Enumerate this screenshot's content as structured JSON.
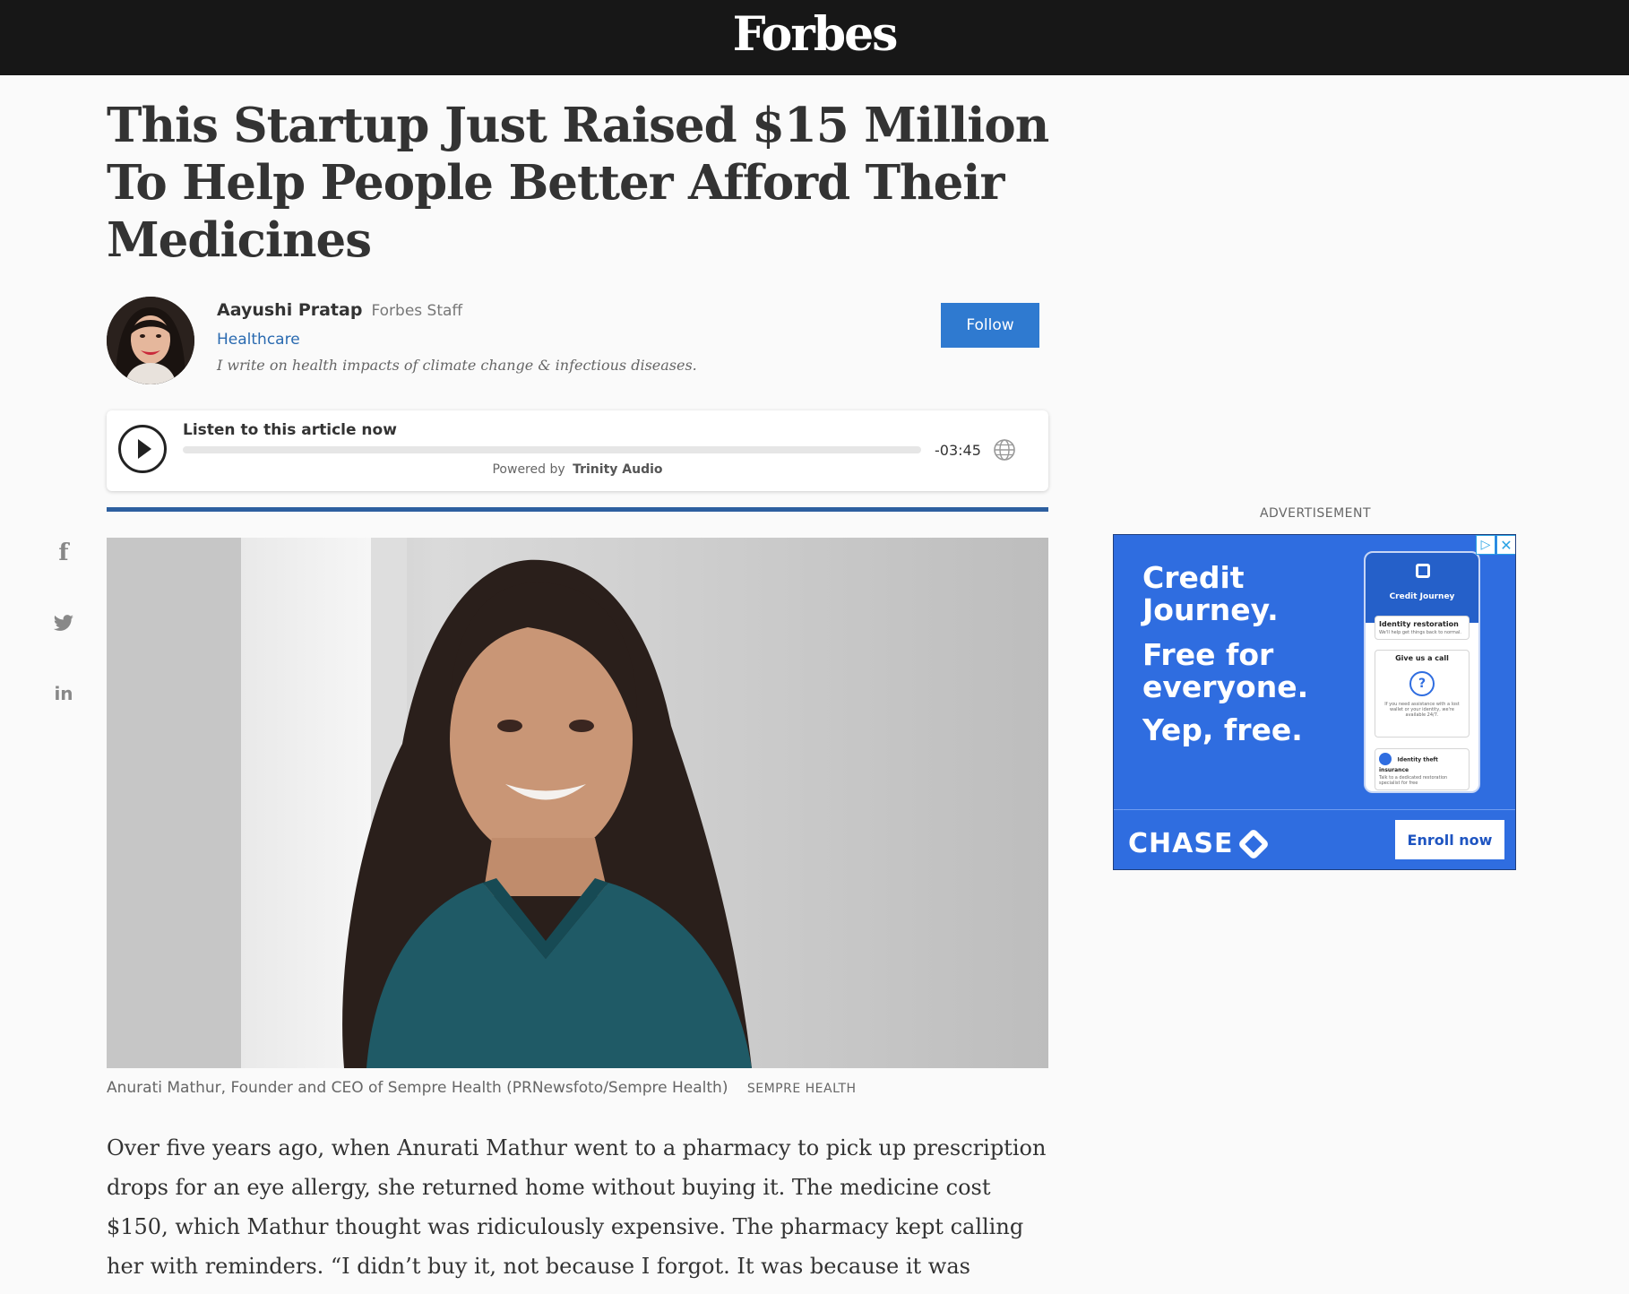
{
  "header": {
    "brand": "Forbes"
  },
  "article": {
    "headline": "This Startup Just Raised $15 Million To Help People Better Afford Their Medicines",
    "author": {
      "name": "Aayushi Pratap",
      "role": "Forbes Staff",
      "category": "Healthcare",
      "bio": "I write on health impacts of climate change & infectious diseases.",
      "follow_label": "Follow"
    },
    "audio": {
      "title": "Listen to this article now",
      "time": "-03:45",
      "powered_by": "Powered by",
      "provider": "Trinity Audio",
      "progress": 0
    },
    "image": {
      "caption": "Anurati Mathur, Founder and CEO of Sempre Health (PRNewsfoto/Sempre Health)",
      "credit": "SEMPRE HEALTH"
    },
    "body": "Over five years ago, when Anurati Mathur went to a pharmacy to pick up prescription drops for an eye allergy, she returned home without buying it. The medicine cost $150, which Mathur thought was ridiculously expensive. The pharmacy kept calling her with reminders. “I didn’t buy it, not because I forgot. It was because it was unaffordable,”"
  },
  "share": {
    "facebook": "f",
    "twitter": "twitter-bird-icon",
    "linkedin": "in"
  },
  "ad": {
    "label": "ADVERTISEMENT",
    "headline_1": "Credit",
    "headline_2": "Journey.",
    "sub_1": "Free for",
    "sub_2": "everyone.",
    "sub_3": "Yep, free.",
    "phone_title": "Credit Journey",
    "card1_title": "Identity restoration",
    "card1_text": "We'll help get things back to normal.",
    "card2_title": "Give us a call",
    "card2_text": "If you need assistance with a lost wallet or your identity, we're available 24/7.",
    "card3_title": "Identity theft insurance",
    "card3_text": "Talk to a dedicated restoration specialist for free",
    "brand": "CHASE",
    "cta": "Enroll now",
    "colors": {
      "background": "#2f6de0",
      "brand_blue": "#1f55c1"
    }
  },
  "colors": {
    "topbar": "#171717",
    "accent": "#2f7ad0",
    "divider": "#2d5f9f",
    "link": "#2a6ab0"
  }
}
